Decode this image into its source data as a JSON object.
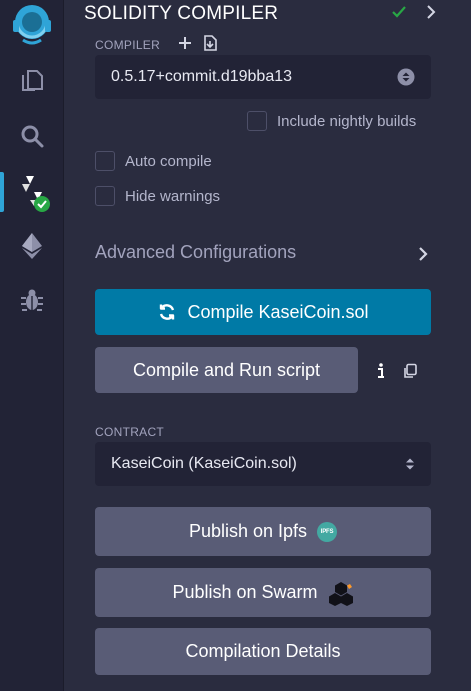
{
  "panel": {
    "title": "SOLIDITY COMPILER"
  },
  "compiler": {
    "section_label": "COMPILER",
    "version": "0.5.17+commit.d19bba13",
    "include_nightly_label": "Include nightly builds",
    "auto_compile_label": "Auto compile",
    "hide_warnings_label": "Hide warnings",
    "advanced_label": "Advanced Configurations",
    "compile_button_label": "Compile KaseiCoin.sol",
    "compile_run_button_label": "Compile and Run script"
  },
  "contract": {
    "section_label": "CONTRACT",
    "selected": "KaseiCoin (KaseiCoin.sol)",
    "publish_ipfs_label": "Publish on Ipfs",
    "ipfs_badge": "IPFS",
    "publish_swarm_label": "Publish on Swarm",
    "details_label": "Compilation Details"
  },
  "colors": {
    "primary": "#007aa6",
    "secondary": "#595c76",
    "success": "#28a745",
    "background": "#2a2c3f"
  }
}
